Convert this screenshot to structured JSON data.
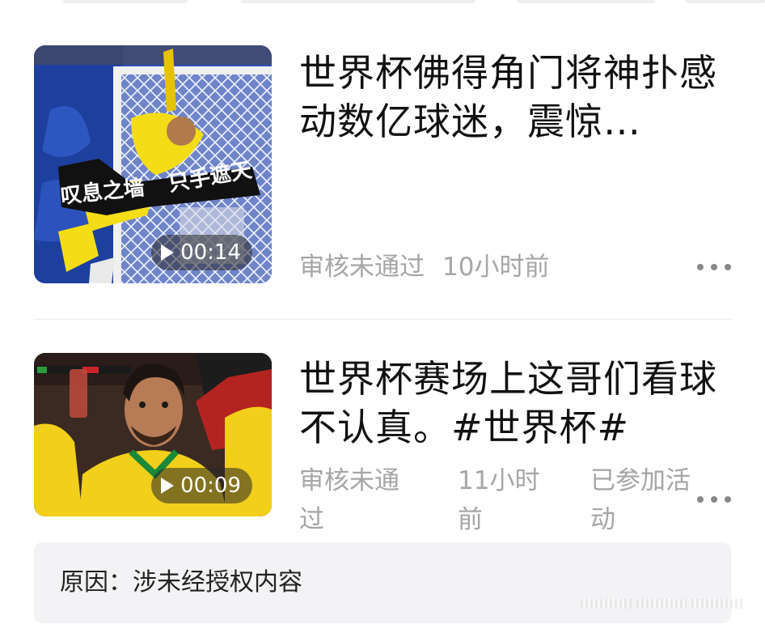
{
  "items": [
    {
      "title": "世界杯佛得角门将神扑感动数亿球迷，震惊…",
      "thumbnail": {
        "caption_left": "叹息之墙",
        "caption_right": "只手遮天",
        "duration": "00:14"
      },
      "status": "审核未通过",
      "time": "10小时前"
    },
    {
      "title": "世界杯赛场上这哥们看球不认真。#世界杯#",
      "thumbnail": {
        "duration": "00:09"
      },
      "status": "审核未通过",
      "time": "11小时前",
      "activity": "已参加活动"
    }
  ],
  "reason": {
    "text": "原因：涉未经授权内容"
  },
  "colors": {
    "meta_gray": "#a6a6a6",
    "reason_bg": "#f3f3f5",
    "title": "#111111"
  },
  "icons": [
    "play-icon",
    "more-icon"
  ]
}
